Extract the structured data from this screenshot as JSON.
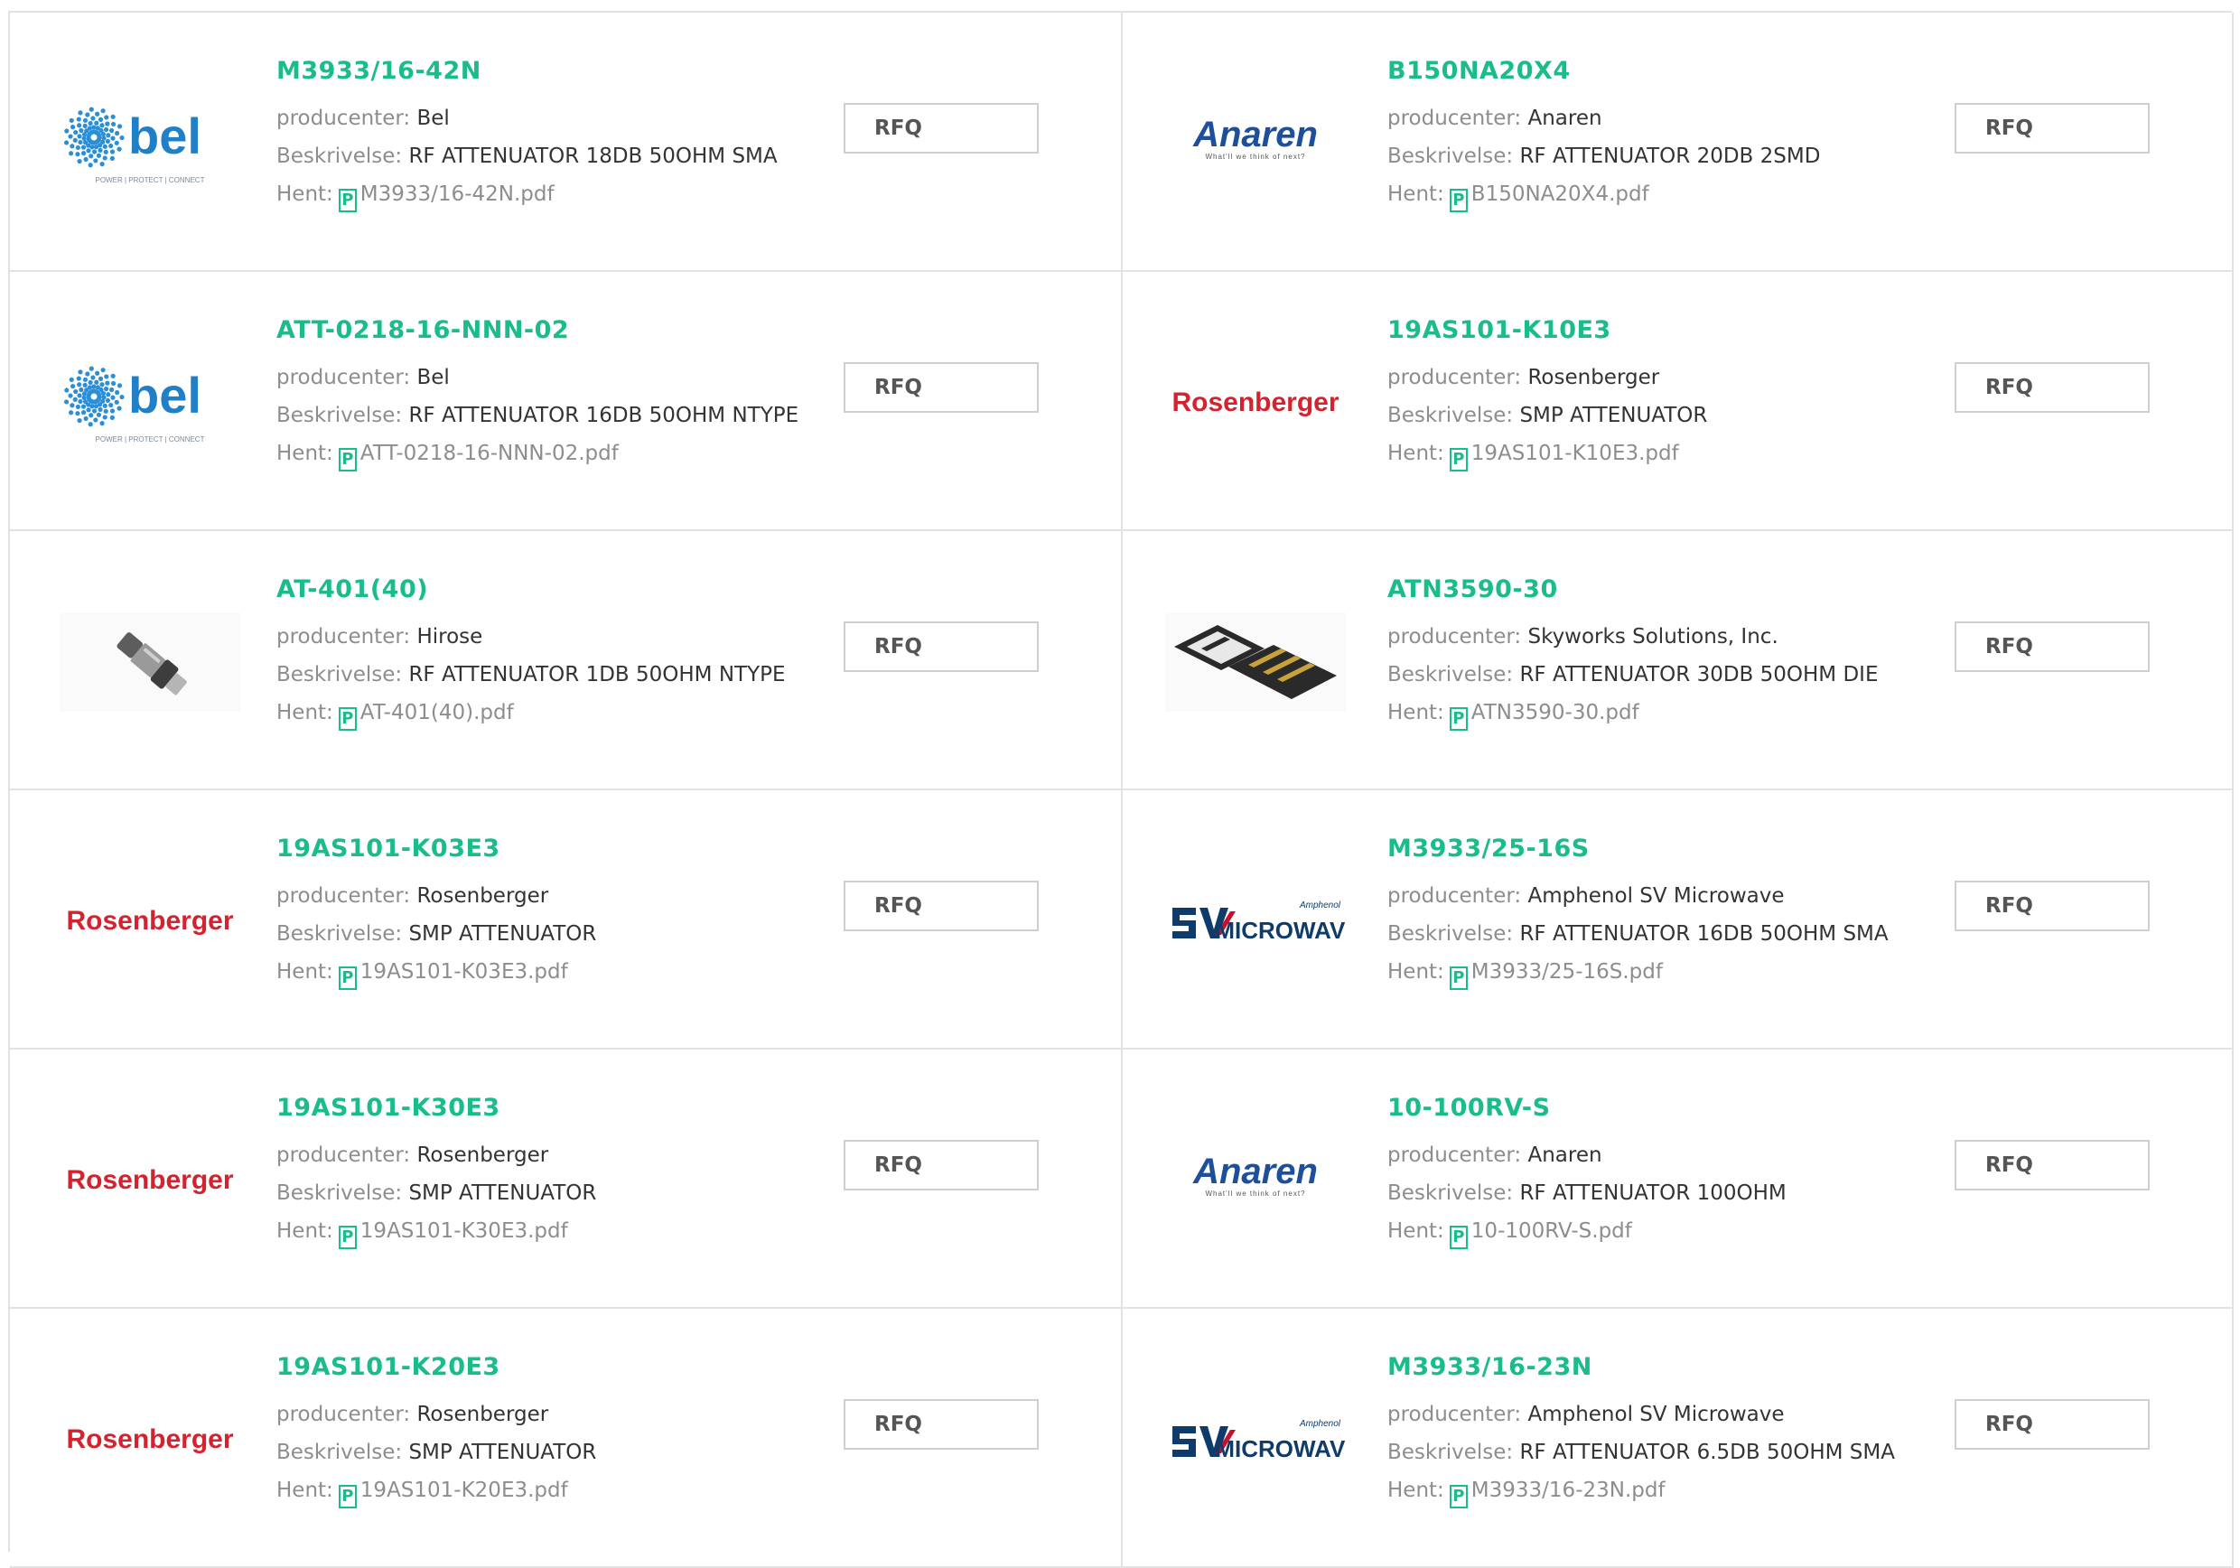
{
  "labels": {
    "manufacturer": "producenter:",
    "description": "Beskrivelse:",
    "download": "Hent:",
    "rfq": "RFQ",
    "pdf_glyph": "P"
  },
  "colors": {
    "accent": "#1abc8c",
    "border": "#e2e2e2",
    "label": "#8d8d8d",
    "text": "#333333"
  },
  "products": [
    {
      "part": "M3933/16-42N",
      "manufacturer": "Bel",
      "description": "RF ATTENUATOR 18DB 50OHM SMA",
      "pdf": "M3933/16-42N.pdf",
      "logo": "bel",
      "logo_text": "bel",
      "logo_tagline": "POWER | PROTECT | CONNECT"
    },
    {
      "part": "B150NA20X4",
      "manufacturer": "Anaren",
      "description": "RF ATTENUATOR 20DB 2SMD",
      "pdf": "B150NA20X4.pdf",
      "logo": "anaren",
      "logo_text": "Anaren",
      "logo_tagline": "What'll we think of next?"
    },
    {
      "part": "ATT-0218-16-NNN-02",
      "manufacturer": "Bel",
      "description": "RF ATTENUATOR 16DB 50OHM NTYPE",
      "pdf": "ATT-0218-16-NNN-02.pdf",
      "logo": "bel",
      "logo_text": "bel",
      "logo_tagline": "POWER | PROTECT | CONNECT"
    },
    {
      "part": "19AS101-K10E3",
      "manufacturer": "Rosenberger",
      "description": "SMP ATTENUATOR",
      "pdf": "19AS101-K10E3.pdf",
      "logo": "rosenberger",
      "logo_text": "Rosenberger",
      "logo_tagline": ""
    },
    {
      "part": "AT-401(40)",
      "manufacturer": "Hirose",
      "description": "RF ATTENUATOR 1DB 50OHM NTYPE",
      "pdf": "AT-401(40).pdf",
      "logo": "connector-photo",
      "logo_text": "",
      "logo_tagline": ""
    },
    {
      "part": "ATN3590-30",
      "manufacturer": "Skyworks Solutions, Inc.",
      "description": "RF ATTENUATOR 30DB 50OHM DIE",
      "pdf": "ATN3590-30.pdf",
      "logo": "chip-photo",
      "logo_text": "",
      "logo_tagline": ""
    },
    {
      "part": "19AS101-K03E3",
      "manufacturer": "Rosenberger",
      "description": "SMP ATTENUATOR",
      "pdf": "19AS101-K03E3.pdf",
      "logo": "rosenberger",
      "logo_text": "Rosenberger",
      "logo_tagline": ""
    },
    {
      "part": "M3933/25-16S",
      "manufacturer": "Amphenol SV Microwave",
      "description": "RF ATTENUATOR 16DB 50OHM SMA",
      "pdf": "M3933/25-16S.pdf",
      "logo": "svmicrowave",
      "logo_text": "MICROWAVE",
      "logo_tagline": "Amphenol"
    },
    {
      "part": "19AS101-K30E3",
      "manufacturer": "Rosenberger",
      "description": "SMP ATTENUATOR",
      "pdf": "19AS101-K30E3.pdf",
      "logo": "rosenberger",
      "logo_text": "Rosenberger",
      "logo_tagline": ""
    },
    {
      "part": "10-100RV-S",
      "manufacturer": "Anaren",
      "description": "RF ATTENUATOR 100OHM",
      "pdf": "10-100RV-S.pdf",
      "logo": "anaren",
      "logo_text": "Anaren",
      "logo_tagline": "What'll we think of next?"
    },
    {
      "part": "19AS101-K20E3",
      "manufacturer": "Rosenberger",
      "description": "SMP ATTENUATOR",
      "pdf": "19AS101-K20E3.pdf",
      "logo": "rosenberger",
      "logo_text": "Rosenberger",
      "logo_tagline": ""
    },
    {
      "part": "M3933/16-23N",
      "manufacturer": "Amphenol SV Microwave",
      "description": "RF ATTENUATOR 6.5DB 50OHM SMA",
      "pdf": "M3933/16-23N.pdf",
      "logo": "svmicrowave",
      "logo_text": "MICROWAVE",
      "logo_tagline": "Amphenol"
    }
  ]
}
